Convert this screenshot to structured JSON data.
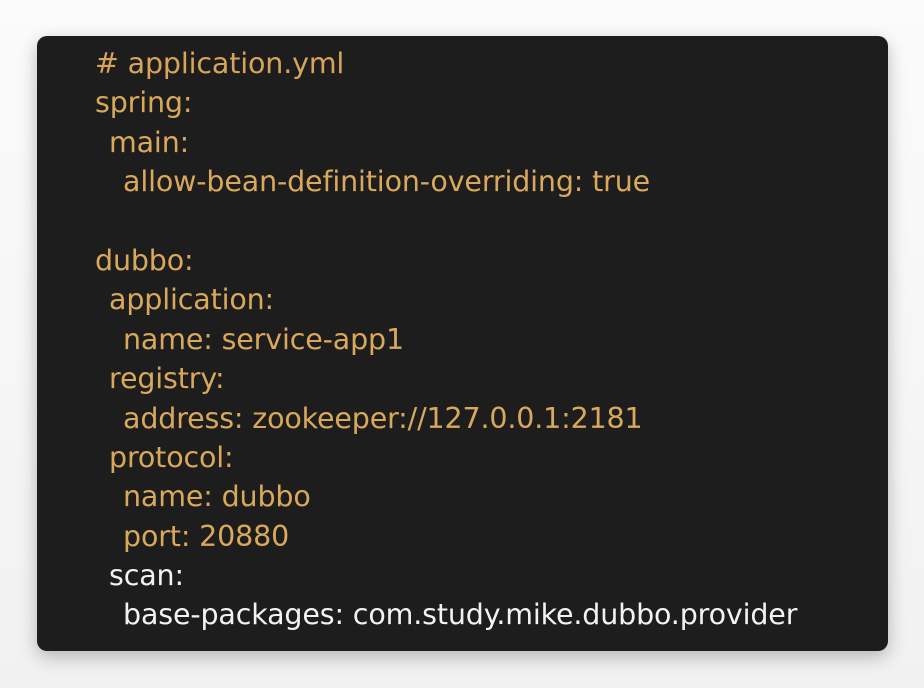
{
  "code": {
    "comment": "# application.yml",
    "lines": [
      "spring:",
      "main:",
      "allow-bean-definition-overriding: true",
      "",
      "dubbo:",
      "application:",
      "name: service-app1",
      "registry:",
      "address: zookeeper://127.0.0.1:2181",
      "protocol:",
      "name: dubbo",
      "port: 20880",
      "scan:",
      "base-packages: com.study.mike.dubbo.provider"
    ]
  },
  "colors": {
    "background": "#1d1d1d",
    "code_text": "#d9a85a",
    "scan_text": "#f2f2f2"
  }
}
